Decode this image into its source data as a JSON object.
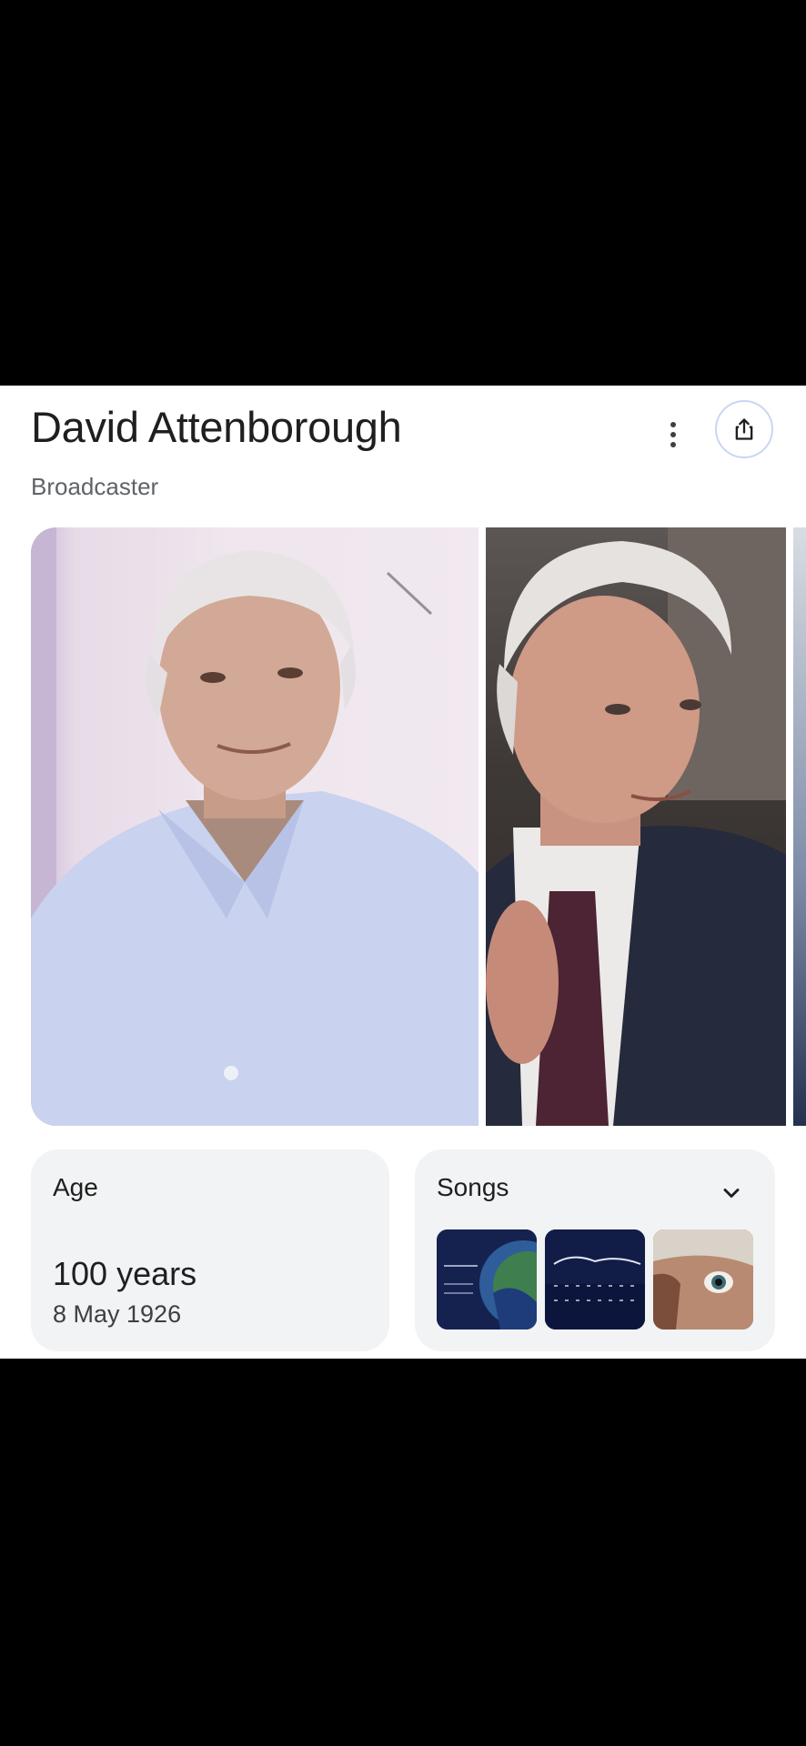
{
  "header": {
    "title": "David Attenborough",
    "subtitle": "Broadcaster",
    "more_icon": "more-vert-icon",
    "share_icon": "share-icon"
  },
  "images": [
    {
      "name": "portrait-photo-1"
    },
    {
      "name": "portrait-photo-2"
    },
    {
      "name": "portrait-photo-3"
    }
  ],
  "age": {
    "label": "Age",
    "value": "100 years",
    "date": "8 May 1926"
  },
  "songs": {
    "label": "Songs",
    "expand_icon": "chevron-down-icon",
    "thumbnails": [
      "song-thumbnail-1",
      "song-thumbnail-2",
      "song-thumbnail-3"
    ]
  },
  "colors": {
    "accent": "#1a73e8",
    "background": "#000000",
    "card": "#ffffff",
    "chip": "#f1f3f4"
  }
}
